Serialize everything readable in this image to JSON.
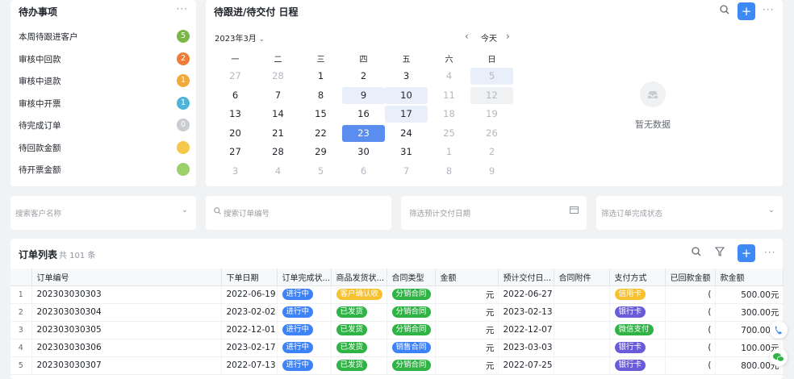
{
  "todo": {
    "title": "待办事项",
    "items": [
      {
        "label": "本周待跟进客户",
        "count": "5",
        "color": "#7ab648"
      },
      {
        "label": "审核中回款",
        "count": "2",
        "color": "#f07d35"
      },
      {
        "label": "审核中退款",
        "count": "1",
        "color": "#f2a93b"
      },
      {
        "label": "审核中开票",
        "count": "1",
        "color": "#4fb4d8"
      },
      {
        "label": "待完成订单",
        "count": "0",
        "color": "#c9ccd1"
      },
      {
        "label": "待回款金额",
        "count": "",
        "color": "#f5c84b"
      },
      {
        "label": "待开票金额",
        "count": "",
        "color": "#9bd06b"
      }
    ]
  },
  "calendar": {
    "title": "待跟进/待交付 日程",
    "month_label": "2023年3月",
    "today_label": "今天",
    "weekdays": [
      "一",
      "二",
      "三",
      "四",
      "五",
      "六",
      "日"
    ],
    "weeks": [
      [
        "27",
        "28",
        "1",
        "2",
        "3",
        "4",
        "5"
      ],
      [
        "6",
        "7",
        "8",
        "9",
        "10",
        "11",
        "12"
      ],
      [
        "13",
        "14",
        "15",
        "16",
        "17",
        "18",
        "19"
      ],
      [
        "20",
        "21",
        "22",
        "23",
        "24",
        "25",
        "26"
      ],
      [
        "27",
        "28",
        "29",
        "30",
        "31",
        "1",
        "2"
      ],
      [
        "3",
        "4",
        "5",
        "6",
        "7",
        "8",
        "9"
      ]
    ],
    "empty_text": "暂无数据"
  },
  "filters": {
    "customer_placeholder": "搜索客户名称",
    "order_placeholder": "搜索订单编号",
    "delivery_placeholder": "筛选预计交付日期",
    "status_placeholder": "筛选订单完成状态"
  },
  "orders": {
    "title": "订单列表",
    "total": "共 101 条",
    "columns": [
      "订单编号",
      "下单日期",
      "订单完成状...",
      "商品发货状...",
      "合同类型",
      "金额",
      "预计交付日...",
      "合同附件",
      "支付方式",
      "已回款金额",
      "款金额"
    ],
    "rows": [
      {
        "idx": "1",
        "id": "202303030303",
        "date": "2022-06-19",
        "status": "进行中",
        "ship": "客户确认收",
        "contract": "分销合同",
        "amount": "元",
        "delivery": "2022-06-27",
        "pay": "信用卡",
        "paid": "(",
        "due": "500.00元"
      },
      {
        "idx": "2",
        "id": "202303030304",
        "date": "2023-02-02",
        "status": "进行中",
        "ship": "已发货",
        "contract": "分销合同",
        "amount": "元",
        "delivery": "2023-02-13",
        "pay": "银行卡",
        "paid": "(",
        "due": "300.00元"
      },
      {
        "idx": "3",
        "id": "202303030305",
        "date": "2022-12-01",
        "status": "进行中",
        "ship": "已发货",
        "contract": "分销合同",
        "amount": "元",
        "delivery": "2022-12-07",
        "pay": "微信支付",
        "paid": "(",
        "due": "700.00元"
      },
      {
        "idx": "4",
        "id": "202303030306",
        "date": "2023-02-17",
        "status": "进行中",
        "ship": "已发货",
        "contract": "销售合同",
        "amount": "元",
        "delivery": "2023-03-03",
        "pay": "银行卡",
        "paid": "(",
        "due": "100.00元"
      },
      {
        "idx": "5",
        "id": "202303030307",
        "date": "2022-07-13",
        "status": "进行中",
        "ship": "已发货",
        "contract": "分销合同",
        "amount": "元",
        "delivery": "2022-07-25",
        "pay": "银行卡",
        "paid": "(",
        "due": "800.00元"
      }
    ]
  }
}
